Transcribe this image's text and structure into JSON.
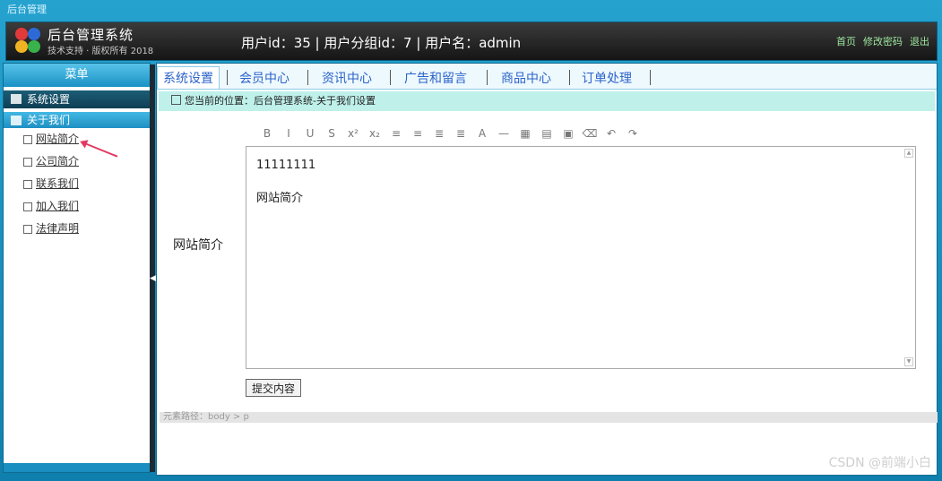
{
  "window": {
    "title": "后台管理"
  },
  "header": {
    "brand_title": "后台管理系统",
    "brand_subtitle": "技术支持 · 版权所有 2018",
    "user_info": "用户id：35 | 用户分组id：7 | 用户名：admin",
    "links": [
      "首页",
      "修改密码",
      "退出"
    ]
  },
  "sidebar": {
    "heading": "菜单",
    "section_main": "系统设置",
    "section_sub": "关于我们",
    "items": [
      {
        "label": "网站简介"
      },
      {
        "label": "公司简介"
      },
      {
        "label": "联系我们"
      },
      {
        "label": "加入我们"
      },
      {
        "label": "法律声明"
      }
    ]
  },
  "tabs": [
    "系统设置",
    "会员中心",
    "资讯中心",
    "广告和留言",
    "商品中心",
    "订单处理"
  ],
  "breadcrumb": "您当前的位置：后台管理系统-关于我们设置",
  "form": {
    "label": "网站简介",
    "content_lines": [
      "11111111",
      "网站简介"
    ],
    "submit_label": "提交内容"
  },
  "editor_toolbar": [
    "B",
    "I",
    "U",
    "S",
    "x²",
    "x₂",
    "≡",
    "≡",
    "≣",
    "≣",
    "A",
    "—",
    "▦",
    "▤",
    "▣",
    "⌫",
    "↶",
    "↷"
  ],
  "statusbar": "元素路径：body > p",
  "watermark": "CSDN @前端小白"
}
